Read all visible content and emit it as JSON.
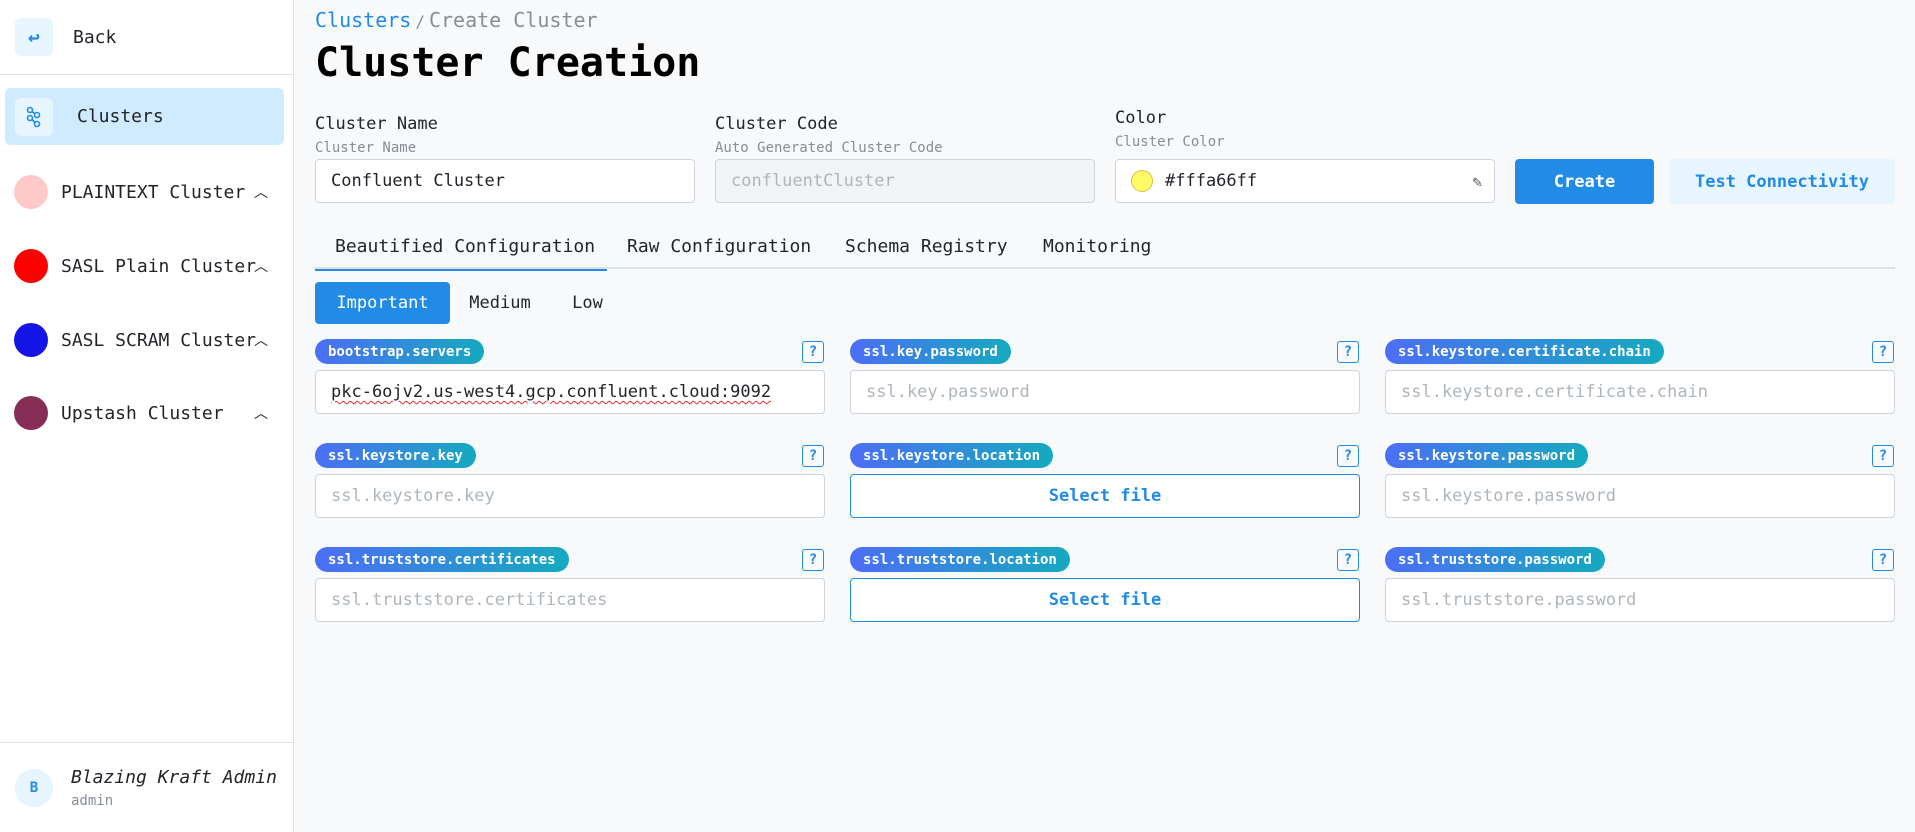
{
  "sidebar": {
    "back_label": "Back",
    "active_item": "Clusters",
    "clusters": [
      {
        "name": "PLAINTEXT Cluster",
        "color": "#ffc9c9"
      },
      {
        "name": "SASL Plain Cluster",
        "color": "#ff0000"
      },
      {
        "name": "SASL SCRAM Cluster",
        "color": "#1414e6"
      },
      {
        "name": "Upstash Cluster",
        "color": "#862e56"
      }
    ],
    "user": {
      "initial": "B",
      "name": "Blazing Kraft Admin",
      "role": "admin"
    }
  },
  "breadcrumb": {
    "link": "Clusters",
    "separator": "/",
    "current": "Create Cluster"
  },
  "page_title": "Cluster Creation",
  "form": {
    "name": {
      "label": "Cluster Name",
      "description": "Cluster Name",
      "value": "Confluent Cluster"
    },
    "code": {
      "label": "Cluster Code",
      "description": "Auto Generated Cluster Code",
      "placeholder": "confluentCluster"
    },
    "color": {
      "label": "Color",
      "description": "Cluster Color",
      "value": "#fffa66ff",
      "swatch": "#fffa66"
    },
    "create_label": "Create",
    "test_label": "Test Connectivity"
  },
  "tabs": [
    "Beautified Configuration",
    "Raw Configuration",
    "Schema Registry",
    "Monitoring"
  ],
  "segments": [
    "Important",
    "Medium",
    "Low"
  ],
  "config": {
    "help": "?",
    "select_file": "Select file",
    "fields": [
      {
        "key": "bootstrap.servers",
        "value": "pkc-6ojv2.us-west4.gcp.confluent.cloud:9092"
      },
      {
        "key": "ssl.key.password",
        "placeholder": "ssl.key.password"
      },
      {
        "key": "ssl.keystore.certificate.chain",
        "placeholder": "ssl.keystore.certificate.chain"
      },
      {
        "key": "ssl.keystore.key",
        "placeholder": "ssl.keystore.key"
      },
      {
        "key": "ssl.keystore.location"
      },
      {
        "key": "ssl.keystore.password",
        "placeholder": "ssl.keystore.password"
      },
      {
        "key": "ssl.truststore.certificates",
        "placeholder": "ssl.truststore.certificates"
      },
      {
        "key": "ssl.truststore.location"
      },
      {
        "key": "ssl.truststore.password",
        "placeholder": "ssl.truststore.password"
      }
    ]
  },
  "colors": {
    "accent": "#228be6",
    "accent_light": "#e7f5ff"
  }
}
